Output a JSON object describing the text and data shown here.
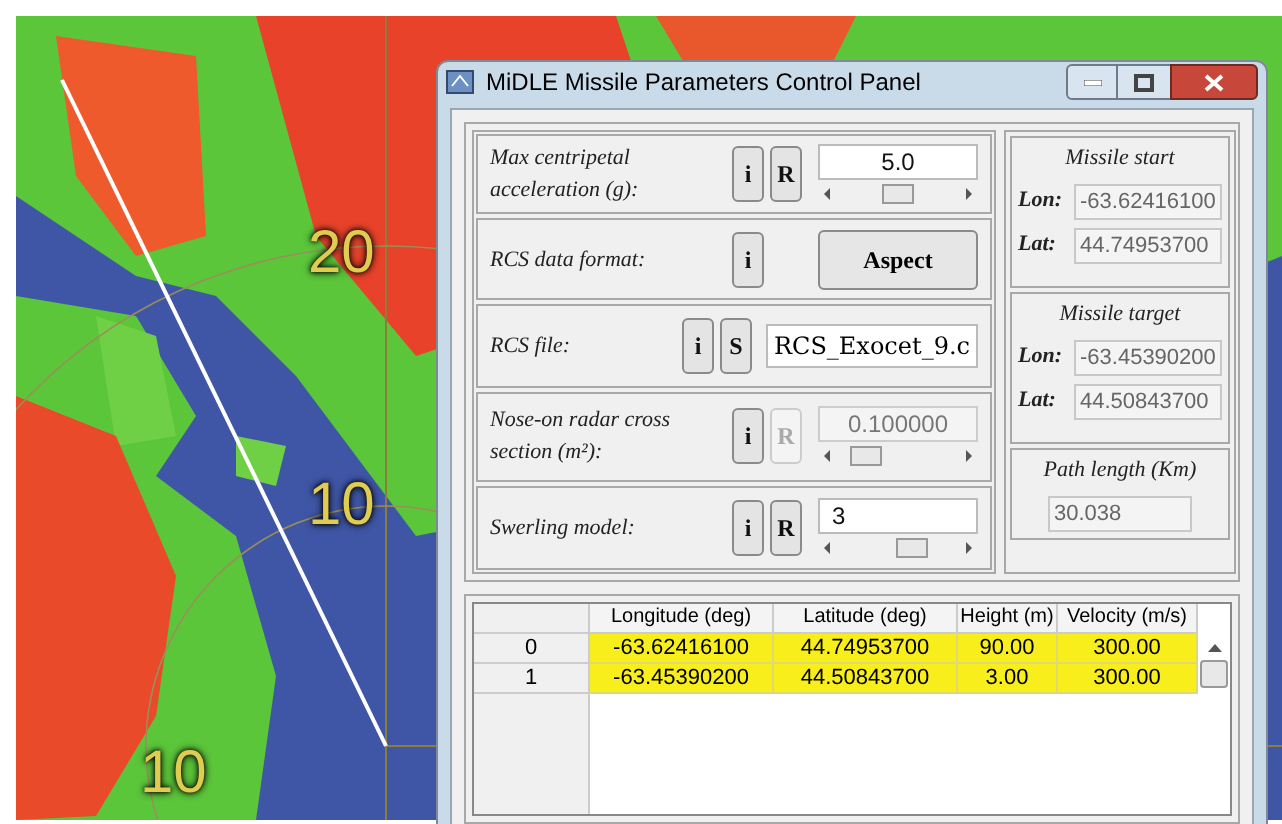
{
  "map_labels": [
    {
      "text": "20"
    },
    {
      "text": "10"
    },
    {
      "text": "10"
    }
  ],
  "window": {
    "title": "MiDLE Missile Parameters Control Panel"
  },
  "parameters": [
    {
      "kind": "slider",
      "label": "Max centripetal acceleration (g):",
      "buttons": [
        {
          "text": "i",
          "disabled": false
        },
        {
          "text": "R",
          "disabled": false
        }
      ],
      "value": "5.0",
      "level": 0.5,
      "disabled": false
    },
    {
      "kind": "choice",
      "label": "RCS data format:",
      "buttons": [
        {
          "text": "i",
          "disabled": false
        }
      ],
      "action": "Aspect"
    },
    {
      "kind": "file",
      "label": "RCS file:",
      "buttons": [
        {
          "text": "i",
          "disabled": false
        },
        {
          "text": "S",
          "disabled": false
        }
      ],
      "value": "RCS_Exocet_9.c"
    },
    {
      "kind": "slider",
      "label": "Nose-on radar cross section (m²):",
      "buttons": [
        {
          "text": "i",
          "disabled": false
        },
        {
          "text": "R",
          "disabled": true
        }
      ],
      "value": "0.100000",
      "level": 0.15,
      "disabled": true
    },
    {
      "kind": "slider",
      "label": "Swerling model:",
      "buttons": [
        {
          "text": "i",
          "disabled": false
        },
        {
          "text": "R",
          "disabled": false
        }
      ],
      "value": "3",
      "level": 0.65,
      "disabled": false
    }
  ],
  "missile_start": {
    "title": "Missile start",
    "fields": [
      {
        "label": "Lon:",
        "value": "-63.62416100"
      },
      {
        "label": "Lat:",
        "value": "44.74953700"
      }
    ]
  },
  "missile_target": {
    "title": "Missile target",
    "fields": [
      {
        "label": "Lon:",
        "value": "-63.45390200"
      },
      {
        "label": "Lat:",
        "value": "44.50843700"
      }
    ]
  },
  "path_length": {
    "title": "Path length (Km)",
    "value": "30.038"
  },
  "table": {
    "columns": [
      "Longitude (deg)",
      "Latitude (deg)",
      "Height (m)",
      "Velocity (m/s)"
    ],
    "rows": [
      {
        "index": "0",
        "selected": true,
        "cells": [
          "-63.62416100",
          "44.74953700",
          "90.00",
          "300.00"
        ]
      },
      {
        "index": "1",
        "selected": true,
        "cells": [
          "-63.45390200",
          "44.50843700",
          "3.00",
          "300.00"
        ]
      }
    ]
  }
}
